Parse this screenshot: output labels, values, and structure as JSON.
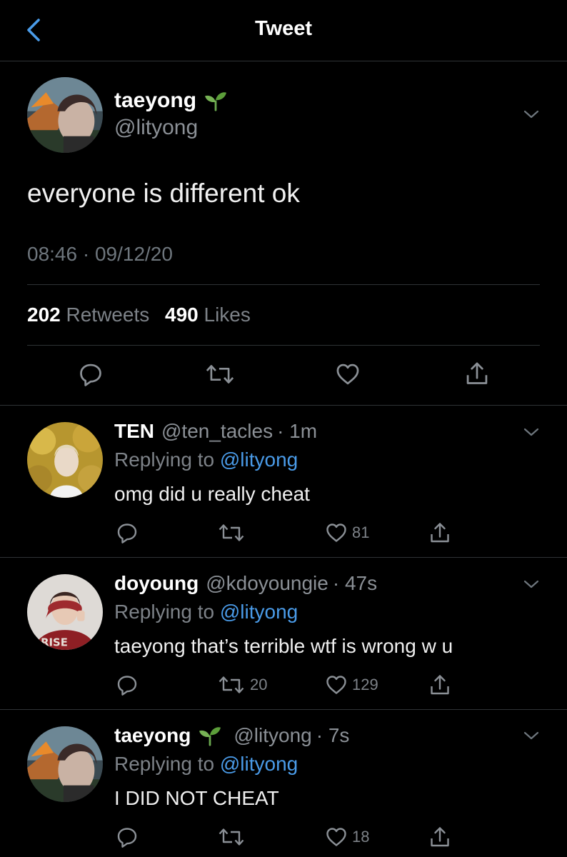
{
  "header": {
    "title": "Tweet",
    "back_icon": "chevron-left-icon"
  },
  "main_tweet": {
    "name": "taeyong",
    "emoji": "🌱",
    "handle": "@lityong",
    "text": "everyone is different ok",
    "timestamp": "08:46 · 09/12/20",
    "retweets": "202",
    "retweets_label": "Retweets",
    "likes": "490",
    "likes_label": "Likes"
  },
  "replies": [
    {
      "name": "TEN",
      "handle": "@ten_tacles",
      "time": "· 1m",
      "replying_prefix": "Replying to",
      "replying_to": "@lityong",
      "text": "omg did u really cheat",
      "retweet_count": "",
      "like_count": "81"
    },
    {
      "name": "doyoung",
      "handle": "@kdoyoungie",
      "time": "· 47s",
      "replying_prefix": "Replying to",
      "replying_to": "@lityong",
      "text": "taeyong that’s terrible wtf is wrong w u",
      "retweet_count": "20",
      "like_count": "129"
    },
    {
      "name": "taeyong",
      "emoji": "🌱",
      "handle": "@lityong",
      "time": "· 7s",
      "replying_prefix": "Replying to",
      "replying_to": "@lityong",
      "text": "I DID NOT CHEAT",
      "retweet_count": "",
      "like_count": "18"
    }
  ],
  "colors": {
    "background": "#000000",
    "link": "#4a9be8",
    "muted": "#7d8288",
    "divider": "#2f3336"
  }
}
